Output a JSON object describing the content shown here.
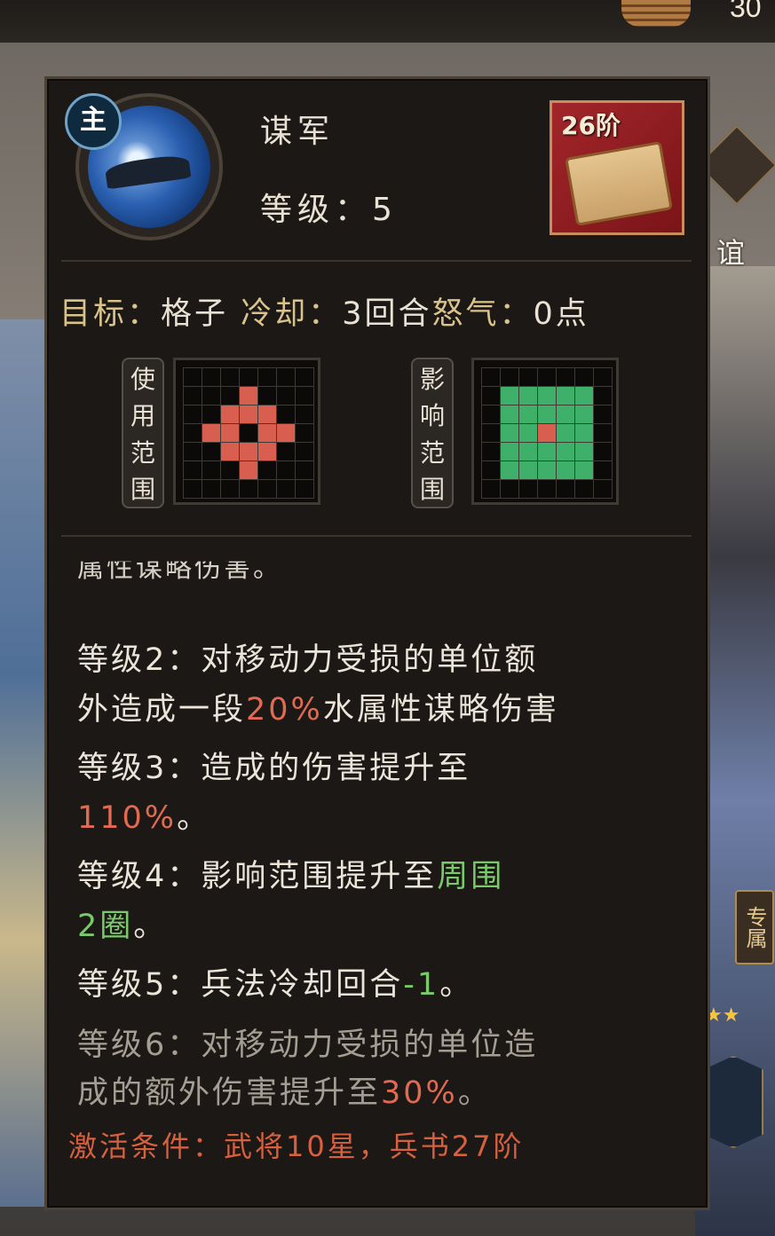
{
  "top_bar": {
    "currency_count": "30"
  },
  "side": {
    "tab_label": "谊",
    "exclusive_label": "专属",
    "stars": "★★"
  },
  "skill": {
    "avatar_badge": "主",
    "name": "谋军",
    "level_text": "等级：5",
    "tier": "26阶"
  },
  "info": {
    "target_label": "目标：",
    "target_value": "格子",
    "cooldown_label": "冷却：",
    "cooldown_value": "3回合",
    "rage_label": "怒气：",
    "rage_value": "0点"
  },
  "ranges": {
    "use_label": [
      "使",
      "用",
      "范",
      "围"
    ],
    "effect_label": [
      "影",
      "响",
      "范",
      "围"
    ],
    "use_grid": [
      "0000000",
      "0001000",
      "0011100",
      "0110110",
      "0011100",
      "0001000",
      "0000000"
    ],
    "effect_grid": [
      "0000000",
      "0222220",
      "0222220",
      "0221220",
      "0222220",
      "0222220",
      "0000000"
    ]
  },
  "description": {
    "cut_line": "属性谋略伤害。",
    "lv2_a": "等级2：对移动力受损的单位额",
    "lv2_b1": "外造成一段",
    "lv2_b2": "20%",
    "lv2_b3": "水属性谋略伤害",
    "lv3_a": "等级3：造成的伤害提升至",
    "lv3_b1": "110%",
    "lv3_b2": "。",
    "lv4_a1": "等级4：影响范围提升至",
    "lv4_a2": "周围",
    "lv4_b1": "2圈",
    "lv4_b2": "。",
    "lv5_a1": "等级5：兵法冷却回合",
    "lv5_a2": "-1",
    "lv5_a3": "。",
    "lv6_a": "等级6：对移动力受损的单位造",
    "lv6_b1": "成的额外伤害提升至",
    "lv6_b2": "30%",
    "lv6_b3": "。",
    "activation": "激活条件：武将10星，兵书27阶"
  },
  "colors": {
    "use_cell": "#d85f50",
    "effect_cell": "#3fb06a",
    "highlight_red": "#e06a52",
    "highlight_green": "#7ac96a",
    "label_gold": "#d9c38b"
  }
}
